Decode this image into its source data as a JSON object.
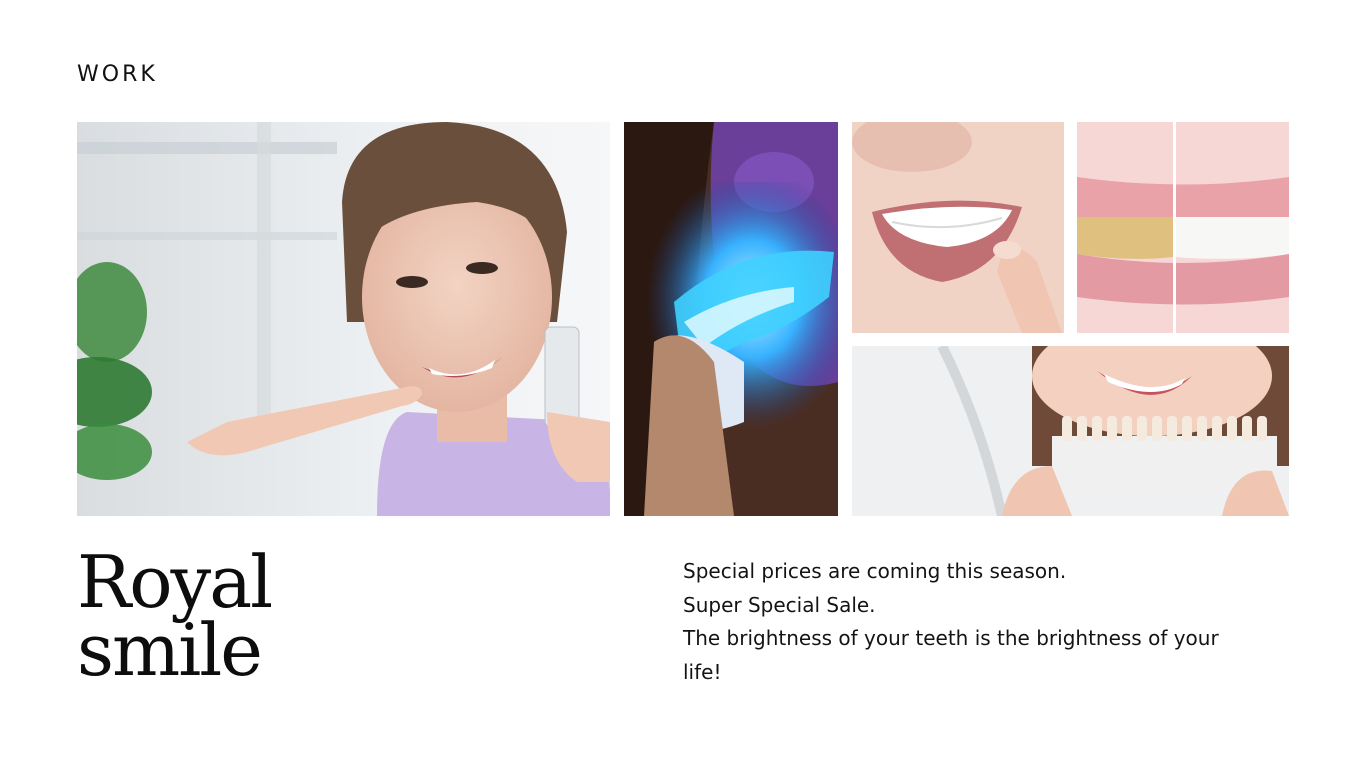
{
  "section_label": "WORK",
  "title": {
    "line1": "Royal",
    "line2": "smile"
  },
  "description": {
    "line1": "Special prices are coming this season.",
    "line2": "Super Special Sale.",
    "line3": "The brightness of your teeth is the brightness of your life!"
  },
  "photos": [
    {
      "name": "woman-pointing-smile-photo",
      "subject": "smiling woman pointing at teeth"
    },
    {
      "name": "blue-light-whitening-photo",
      "subject": "blue light teeth whitening tray"
    },
    {
      "name": "smile-closeup-photo",
      "subject": "close-up of smile"
    },
    {
      "name": "before-after-teeth-photo",
      "subject": "before and after teeth whitening"
    },
    {
      "name": "shade-guide-photo",
      "subject": "woman holding tooth shade guide"
    }
  ],
  "colors": {
    "background": "#ffffff",
    "text": "#111111",
    "whitening_blue": "#2fa6ff",
    "lip_pink": "#e8a2a8"
  }
}
